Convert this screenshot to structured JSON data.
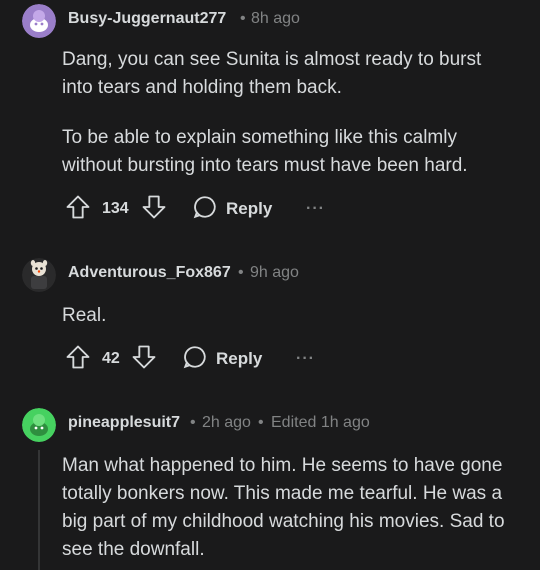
{
  "comments": [
    {
      "username": "Busy-Juggernaut277",
      "time": "8h ago",
      "paragraphs": [
        "Dang, you can see Sunita is almost ready to burst into tears and holding them back.",
        "To be able to explain something like this calmly without bursting into tears must have been hard."
      ],
      "votes": "134",
      "reply_label": "Reply",
      "more_label": "···",
      "avatar_color": "#9a7ec9"
    },
    {
      "username": "Adventurous_Fox867",
      "time": "9h ago",
      "paragraphs": [
        "Real."
      ],
      "votes": "42",
      "reply_label": "Reply",
      "more_label": "···",
      "avatar_color": "#2a2a2b"
    },
    {
      "username": "pineapplesuit7",
      "time": "2h ago",
      "edited": "Edited 1h ago",
      "paragraphs": [
        "Man what happened to him. He seems to have gone totally bonkers now. This made me tearful. He was a big part of my childhood watching his movies. Sad to see the downfall."
      ],
      "avatar_color": "#46d160"
    }
  ],
  "separator": "•",
  "icons": {
    "upvote": "upvote-arrow-icon",
    "downvote": "downvote-arrow-icon",
    "reply": "speech-bubble-icon",
    "more": "more-dots-icon"
  }
}
